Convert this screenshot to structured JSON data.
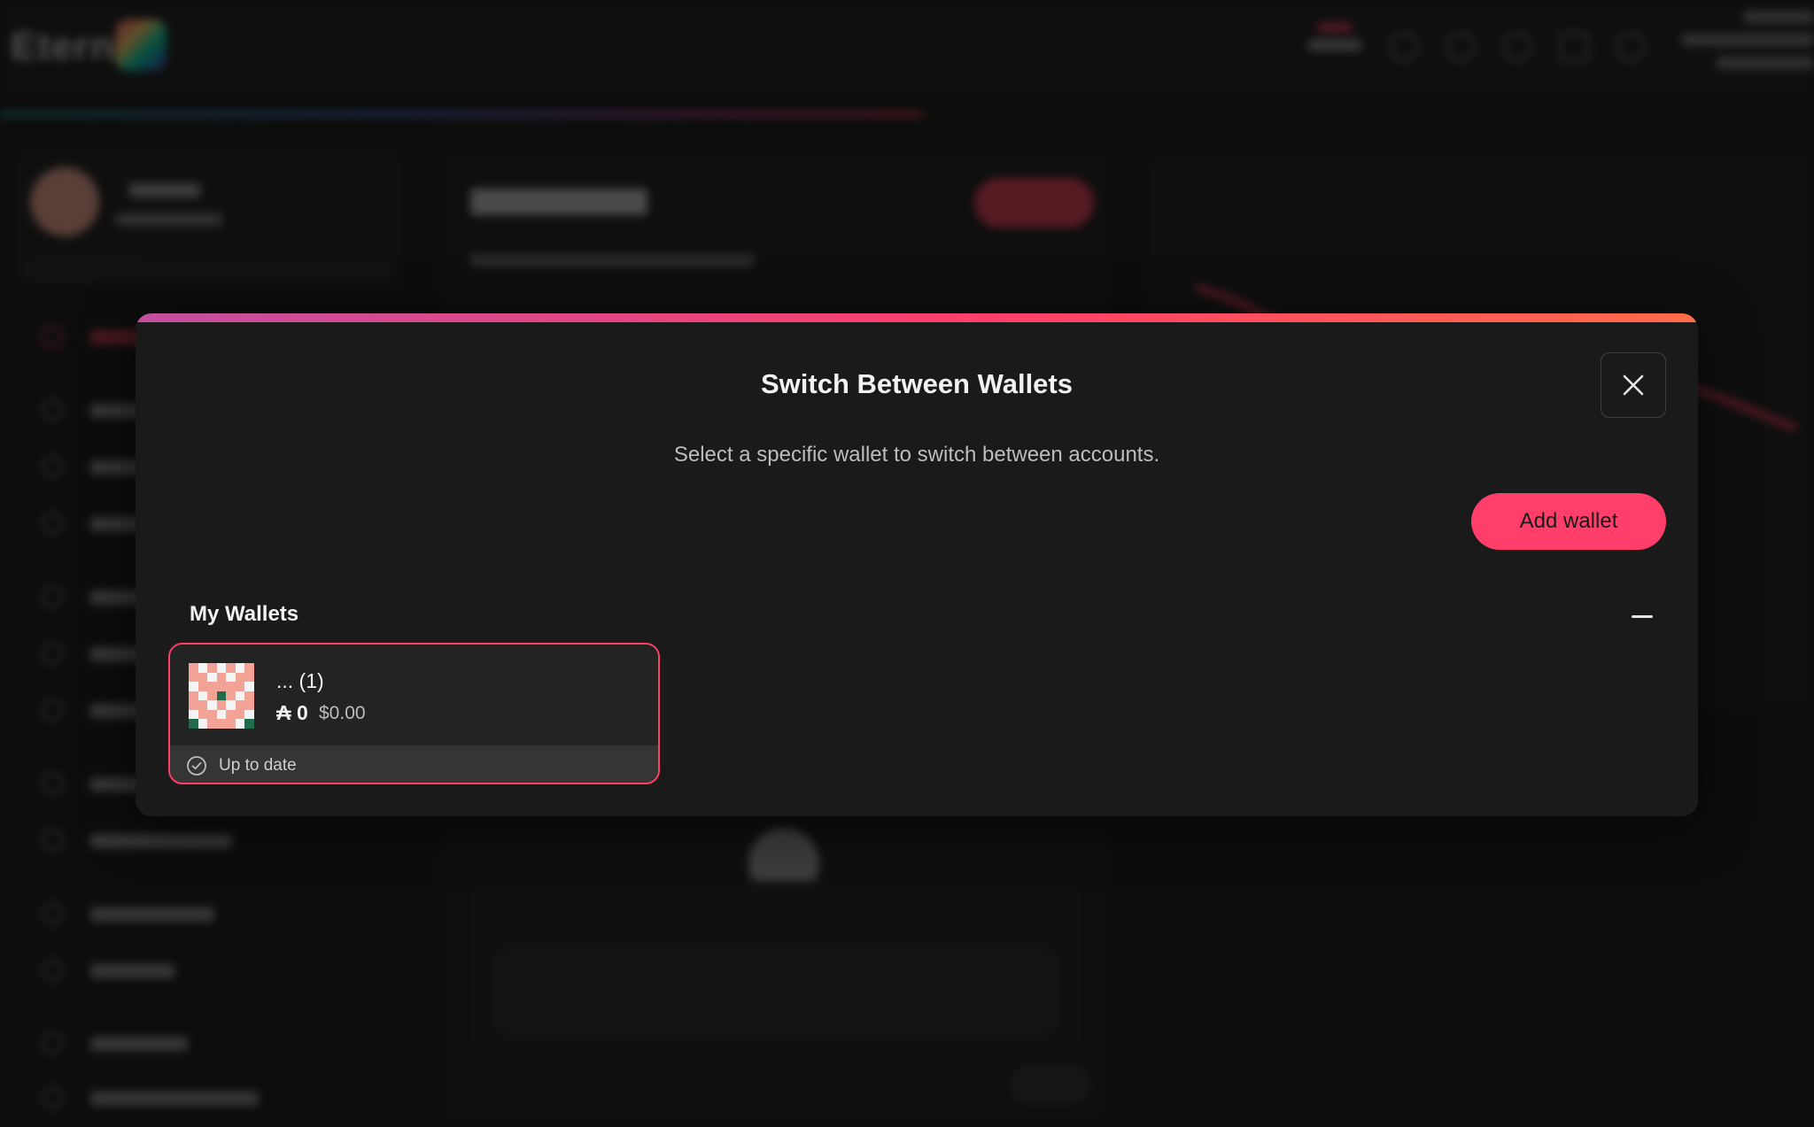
{
  "modal": {
    "title": "Switch Between Wallets",
    "subtitle": "Select a specific wallet to switch between accounts.",
    "add_wallet_label": "Add wallet",
    "close_icon": "close-icon",
    "section_title": "My Wallets",
    "collapse_icon": "minus-icon",
    "accent_color": "#ff3f6a"
  },
  "wallets": [
    {
      "name": "... (1)",
      "balance": "₳ 0",
      "balance_usd": "$0.00",
      "status": "Up to date",
      "status_icon": "check-circle-icon"
    }
  ]
}
